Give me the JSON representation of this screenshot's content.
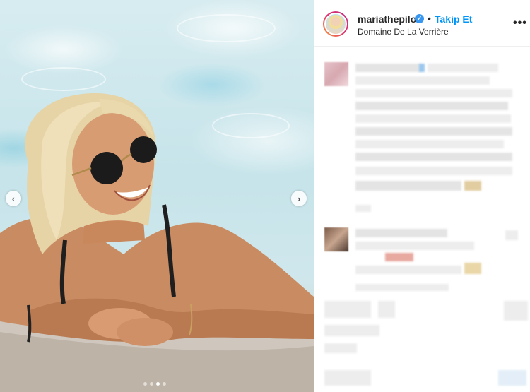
{
  "post": {
    "username": "mariathepilot",
    "follow_label": "Takip Et",
    "separator": "•",
    "location": "Domaine De La Verrière",
    "verified_glyph": "✓",
    "more_glyph": "•••"
  },
  "carousel": {
    "prev_glyph": "‹",
    "next_glyph": "›",
    "slide_count": 4,
    "active_slide": 3
  },
  "colors": {
    "follow_blue": "#0095f6",
    "verified_blue": "#3897f0",
    "text_dark": "#262626"
  },
  "icons": [
    "verified-badge-icon",
    "more-options-icon",
    "chevron-left-icon",
    "chevron-right-icon"
  ]
}
